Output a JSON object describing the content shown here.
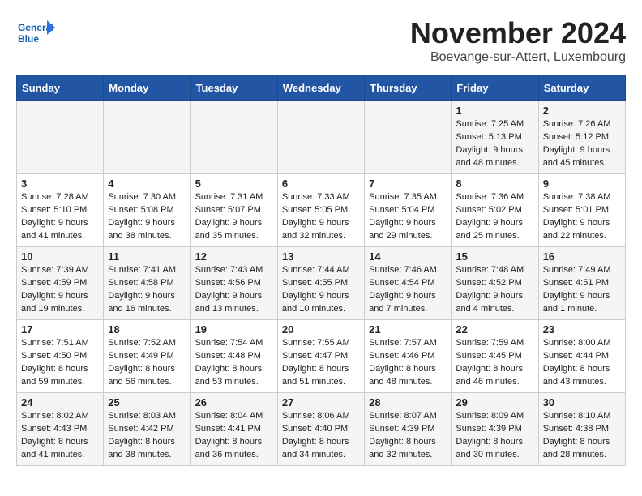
{
  "logo": {
    "line1": "General",
    "line2": "Blue"
  },
  "title": "November 2024",
  "location": "Boevange-sur-Attert, Luxembourg",
  "headers": [
    "Sunday",
    "Monday",
    "Tuesday",
    "Wednesday",
    "Thursday",
    "Friday",
    "Saturday"
  ],
  "weeks": [
    [
      {
        "day": "",
        "detail": ""
      },
      {
        "day": "",
        "detail": ""
      },
      {
        "day": "",
        "detail": ""
      },
      {
        "day": "",
        "detail": ""
      },
      {
        "day": "",
        "detail": ""
      },
      {
        "day": "1",
        "detail": "Sunrise: 7:25 AM\nSunset: 5:13 PM\nDaylight: 9 hours\nand 48 minutes."
      },
      {
        "day": "2",
        "detail": "Sunrise: 7:26 AM\nSunset: 5:12 PM\nDaylight: 9 hours\nand 45 minutes."
      }
    ],
    [
      {
        "day": "3",
        "detail": "Sunrise: 7:28 AM\nSunset: 5:10 PM\nDaylight: 9 hours\nand 41 minutes."
      },
      {
        "day": "4",
        "detail": "Sunrise: 7:30 AM\nSunset: 5:08 PM\nDaylight: 9 hours\nand 38 minutes."
      },
      {
        "day": "5",
        "detail": "Sunrise: 7:31 AM\nSunset: 5:07 PM\nDaylight: 9 hours\nand 35 minutes."
      },
      {
        "day": "6",
        "detail": "Sunrise: 7:33 AM\nSunset: 5:05 PM\nDaylight: 9 hours\nand 32 minutes."
      },
      {
        "day": "7",
        "detail": "Sunrise: 7:35 AM\nSunset: 5:04 PM\nDaylight: 9 hours\nand 29 minutes."
      },
      {
        "day": "8",
        "detail": "Sunrise: 7:36 AM\nSunset: 5:02 PM\nDaylight: 9 hours\nand 25 minutes."
      },
      {
        "day": "9",
        "detail": "Sunrise: 7:38 AM\nSunset: 5:01 PM\nDaylight: 9 hours\nand 22 minutes."
      }
    ],
    [
      {
        "day": "10",
        "detail": "Sunrise: 7:39 AM\nSunset: 4:59 PM\nDaylight: 9 hours\nand 19 minutes."
      },
      {
        "day": "11",
        "detail": "Sunrise: 7:41 AM\nSunset: 4:58 PM\nDaylight: 9 hours\nand 16 minutes."
      },
      {
        "day": "12",
        "detail": "Sunrise: 7:43 AM\nSunset: 4:56 PM\nDaylight: 9 hours\nand 13 minutes."
      },
      {
        "day": "13",
        "detail": "Sunrise: 7:44 AM\nSunset: 4:55 PM\nDaylight: 9 hours\nand 10 minutes."
      },
      {
        "day": "14",
        "detail": "Sunrise: 7:46 AM\nSunset: 4:54 PM\nDaylight: 9 hours\nand 7 minutes."
      },
      {
        "day": "15",
        "detail": "Sunrise: 7:48 AM\nSunset: 4:52 PM\nDaylight: 9 hours\nand 4 minutes."
      },
      {
        "day": "16",
        "detail": "Sunrise: 7:49 AM\nSunset: 4:51 PM\nDaylight: 9 hours\nand 1 minute."
      }
    ],
    [
      {
        "day": "17",
        "detail": "Sunrise: 7:51 AM\nSunset: 4:50 PM\nDaylight: 8 hours\nand 59 minutes."
      },
      {
        "day": "18",
        "detail": "Sunrise: 7:52 AM\nSunset: 4:49 PM\nDaylight: 8 hours\nand 56 minutes."
      },
      {
        "day": "19",
        "detail": "Sunrise: 7:54 AM\nSunset: 4:48 PM\nDaylight: 8 hours\nand 53 minutes."
      },
      {
        "day": "20",
        "detail": "Sunrise: 7:55 AM\nSunset: 4:47 PM\nDaylight: 8 hours\nand 51 minutes."
      },
      {
        "day": "21",
        "detail": "Sunrise: 7:57 AM\nSunset: 4:46 PM\nDaylight: 8 hours\nand 48 minutes."
      },
      {
        "day": "22",
        "detail": "Sunrise: 7:59 AM\nSunset: 4:45 PM\nDaylight: 8 hours\nand 46 minutes."
      },
      {
        "day": "23",
        "detail": "Sunrise: 8:00 AM\nSunset: 4:44 PM\nDaylight: 8 hours\nand 43 minutes."
      }
    ],
    [
      {
        "day": "24",
        "detail": "Sunrise: 8:02 AM\nSunset: 4:43 PM\nDaylight: 8 hours\nand 41 minutes."
      },
      {
        "day": "25",
        "detail": "Sunrise: 8:03 AM\nSunset: 4:42 PM\nDaylight: 8 hours\nand 38 minutes."
      },
      {
        "day": "26",
        "detail": "Sunrise: 8:04 AM\nSunset: 4:41 PM\nDaylight: 8 hours\nand 36 minutes."
      },
      {
        "day": "27",
        "detail": "Sunrise: 8:06 AM\nSunset: 4:40 PM\nDaylight: 8 hours\nand 34 minutes."
      },
      {
        "day": "28",
        "detail": "Sunrise: 8:07 AM\nSunset: 4:39 PM\nDaylight: 8 hours\nand 32 minutes."
      },
      {
        "day": "29",
        "detail": "Sunrise: 8:09 AM\nSunset: 4:39 PM\nDaylight: 8 hours\nand 30 minutes."
      },
      {
        "day": "30",
        "detail": "Sunrise: 8:10 AM\nSunset: 4:38 PM\nDaylight: 8 hours\nand 28 minutes."
      }
    ]
  ]
}
